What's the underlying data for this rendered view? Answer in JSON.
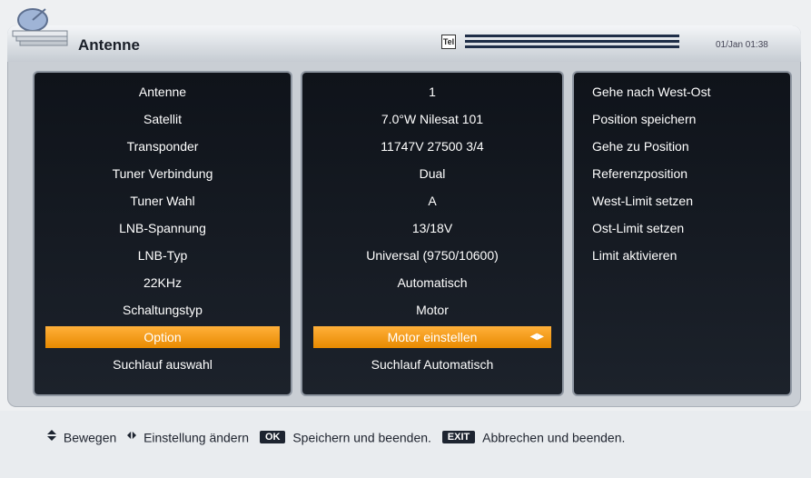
{
  "header": {
    "title": "Antenne",
    "datetime": "01/Jan 01:38",
    "signal_icon_label": "Tel",
    "icons": [
      "satellite-dish-logo-icon",
      "signal-icon"
    ]
  },
  "left_column": {
    "items": [
      "Antenne",
      "Satellit",
      "Transponder",
      "Tuner Verbindung",
      "Tuner Wahl",
      "LNB-Spannung",
      "LNB-Typ",
      "22KHz",
      "Schaltungstyp",
      "Option",
      "Suchlauf auswahl"
    ],
    "selected_index": 9
  },
  "middle_column": {
    "items": [
      "1",
      "7.0°W Nilesat 101",
      "11747V 27500 3/4",
      "Dual",
      "A",
      "13/18V",
      "Universal (9750/10600)",
      "Automatisch",
      "Motor",
      "Motor einstellen",
      "Suchlauf Automatisch"
    ],
    "selected_index": 9
  },
  "right_column": {
    "items": [
      "Gehe nach West-Ost",
      "Position speichern",
      "Gehe zu Position",
      "Referenzposition",
      "West-Limit setzen",
      "Ost-Limit setzen",
      "Limit aktivieren"
    ]
  },
  "footer": {
    "move_label": "Bewegen",
    "change_label": "Einstellung ändern",
    "ok_key": "OK",
    "ok_label": "Speichern und beenden.",
    "exit_key": "EXIT",
    "exit_label": "Abbrechen und beenden."
  },
  "colors": {
    "accent": "#f29a10",
    "panel_bg": "#141920",
    "frame": "#c9ced4"
  }
}
